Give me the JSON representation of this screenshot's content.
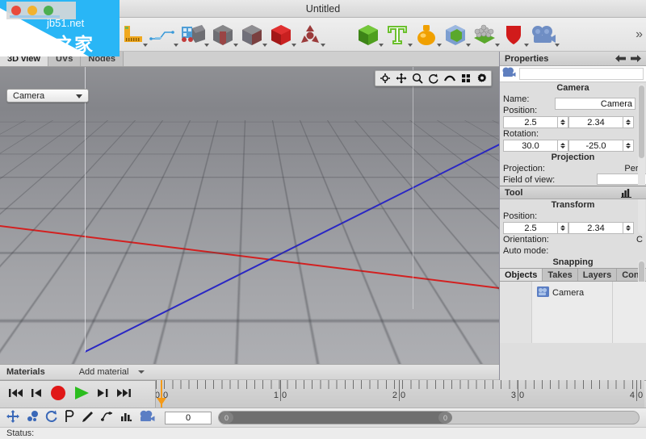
{
  "window": {
    "title": "Untitled",
    "traffic_lights": [
      "close-button",
      "minimize-button",
      "zoom-button"
    ]
  },
  "watermark": {
    "url": "jb51.net",
    "text": "脚本之家"
  },
  "toolbar": {
    "overflow_label": "»",
    "items": [
      {
        "name": "ruler-tool",
        "label": "Ruler"
      },
      {
        "name": "wireframe-tool",
        "label": "Wireframe"
      },
      {
        "name": "selection-tool",
        "label": "Selection"
      },
      {
        "name": "object-cube-tool",
        "label": "Object"
      },
      {
        "name": "extrude-tool",
        "label": "Extrude"
      },
      {
        "name": "cube-grey-tool",
        "label": "Cube"
      },
      {
        "name": "cube-red-tool",
        "label": "Solid"
      },
      {
        "name": "manipulator-tool",
        "label": "Manipulator"
      },
      {
        "name": "primitive-cube-tool",
        "label": "Primitive"
      },
      {
        "name": "text-tool",
        "label": "Text"
      },
      {
        "name": "lathe-tool",
        "label": "Lathe"
      },
      {
        "name": "boolean-tool",
        "label": "Boolean"
      },
      {
        "name": "particles-tool",
        "label": "Particles"
      },
      {
        "name": "shield-tool",
        "label": "Shield"
      },
      {
        "name": "camera-tool",
        "label": "Camera"
      }
    ]
  },
  "viewport": {
    "tabs": [
      {
        "label": "3D view",
        "active": true
      },
      {
        "label": "UVs",
        "active": false
      },
      {
        "label": "Nodes",
        "active": false
      }
    ],
    "camera_selector": "Camera",
    "tools": [
      "orbit-icon",
      "pan-icon",
      "zoom-icon",
      "rotate-icon",
      "arc-icon",
      "grid-icon",
      "gear-icon"
    ],
    "axis_colors": {
      "x": "#d32020",
      "y": "#ebebf0",
      "z": "#2a27c4"
    }
  },
  "materials": {
    "title": "Materials",
    "add_label": "Add material"
  },
  "properties": {
    "title": "Properties",
    "object_icon": "camera-icon",
    "object_field_value": "",
    "sections": {
      "camera": {
        "title": "Camera",
        "name_label": "Name:",
        "name_value": "Camera",
        "position_label": "Position:",
        "position_x": "2.5",
        "position_y": "2.34",
        "rotation_label": "Rotation:",
        "rotation_x": "30.0",
        "rotation_y": "-25.0"
      },
      "projection": {
        "title": "Projection",
        "projection_label": "Projection:",
        "projection_value": "Pers",
        "fov_label": "Field of view:",
        "fov_value": ""
      }
    }
  },
  "tool_panel": {
    "title": "Tool",
    "icon": "histogram-icon",
    "transform": {
      "title": "Transform",
      "position_label": "Position:",
      "position_x": "2.5",
      "position_y": "2.34",
      "orientation_label": "Orientation:",
      "orientation_value": "C",
      "auto_mode_label": "Auto mode:"
    },
    "snapping": {
      "title": "Snapping"
    }
  },
  "outliner": {
    "tabs": [
      {
        "label": "Objects",
        "active": true
      },
      {
        "label": "Takes",
        "active": false
      },
      {
        "label": "Layers",
        "active": false
      },
      {
        "label": "Con",
        "active": false
      }
    ],
    "items": [
      {
        "label": "Camera",
        "icon": "camera-icon"
      }
    ]
  },
  "timeline": {
    "transport": [
      "skip-to-start-button",
      "step-back-button",
      "record-button",
      "play-button",
      "step-forward-button",
      "skip-to-end-button"
    ],
    "ruler_labels": [
      "0|0",
      "1|0",
      "2|0",
      "3|0",
      "4|0"
    ],
    "playhead_frame": "0"
  },
  "bottom_toolbar": {
    "icons": [
      "move-icon",
      "keyframe-icon",
      "loop-icon",
      "pose-icon",
      "pen-icon",
      "graph-icon",
      "bars-icon",
      "camera-icon"
    ],
    "frame_value": "0",
    "range_start": "0",
    "range_end": "0"
  },
  "status_bar": {
    "label": "Status:"
  }
}
